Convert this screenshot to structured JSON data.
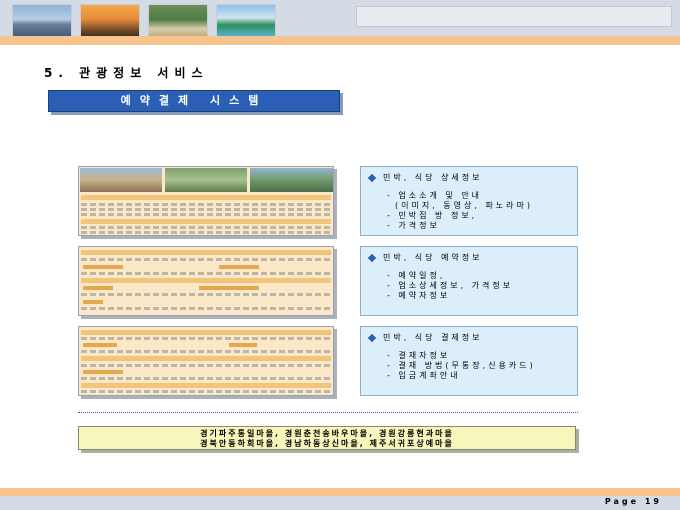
{
  "section_title": "5. 관광정보 서비스",
  "banner": "예약결제 시스템",
  "info_boxes": [
    {
      "heading": "민박, 식당 상세정보",
      "lines": [
        "- 업소소개 및 안내",
        "(이미지, 동영상, 파노라마)",
        "- 민박집 방 정보,",
        "- 가격정보"
      ]
    },
    {
      "heading": "민박, 식당 예약정보",
      "lines": [
        "- 예약일정,",
        "- 업소상세정보, 가격정보",
        "- 예약자정보"
      ]
    },
    {
      "heading": "민박, 식당 결제정보",
      "lines": [
        "- 결재자정보",
        "- 결재 방법(무통장,신용카드)",
        "- 입금계좌안내"
      ]
    }
  ],
  "villages": {
    "line1": "경기파주통일마을, 경원춘천송바우마을, 경원강릉현과마을",
    "line2": "경북안동하회마을, 경남하동상신마을, 제주서귀포상예마을"
  },
  "page": {
    "label": "Page 19"
  },
  "colors": {
    "banner": "#2b5fb5",
    "info_bg": "#ddeefb",
    "village_bg": "#f7f6bd",
    "accent_orange": "#f7c48d",
    "header_band": "#d5dbe4"
  }
}
